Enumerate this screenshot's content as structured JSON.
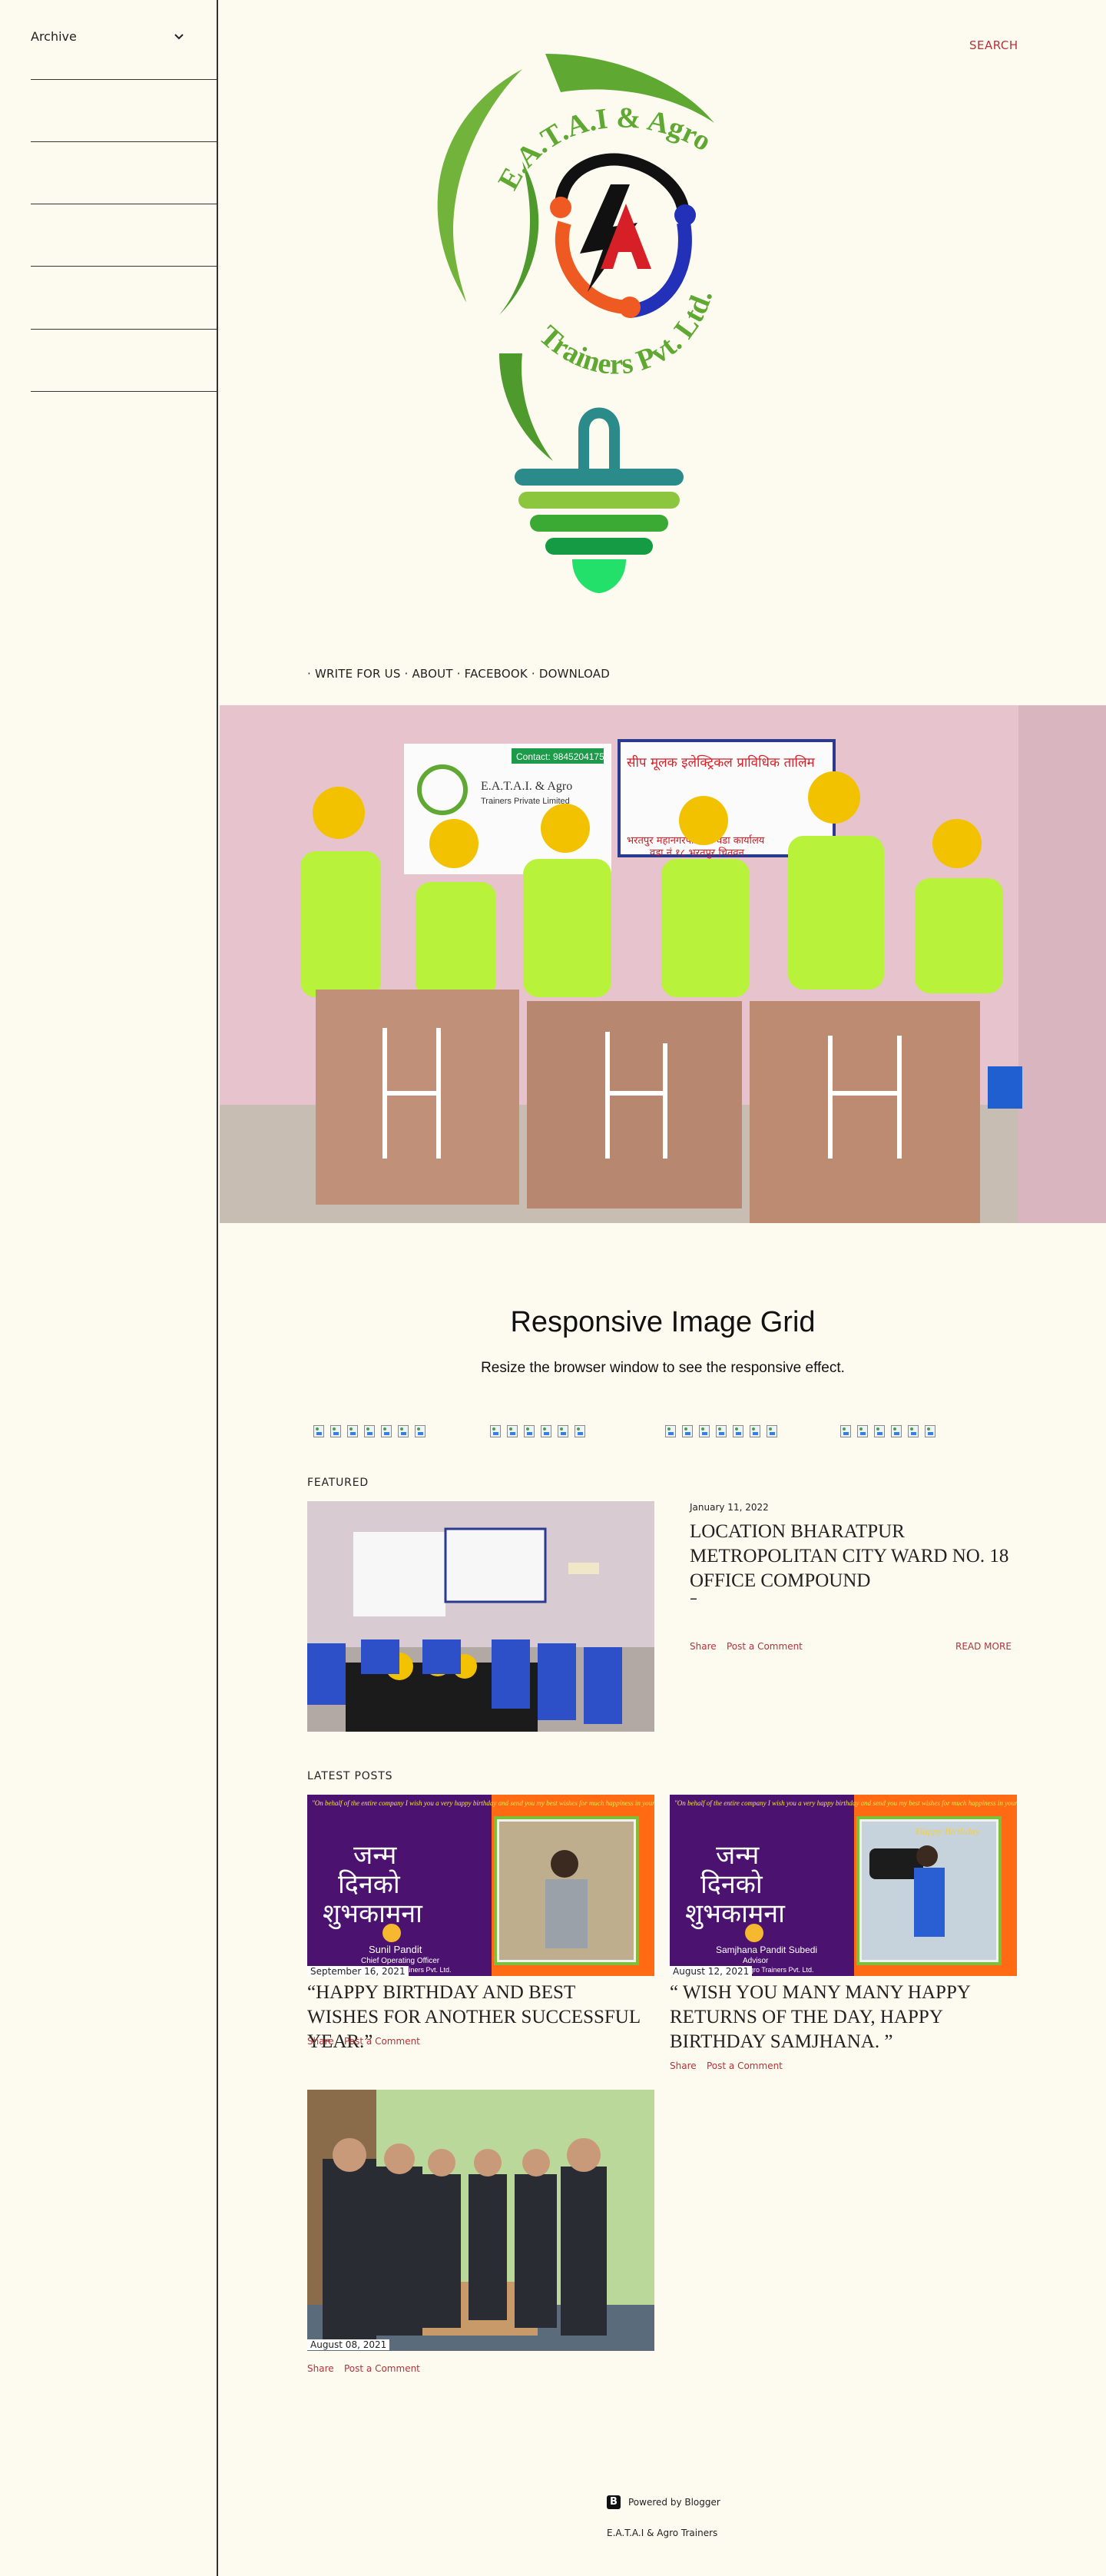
{
  "sidebar": {
    "archive_label": "Archive"
  },
  "header": {
    "search_label": "SEARCH",
    "logo_text_top": "E.A.T.A.I & Agro",
    "logo_text_bottom": "Trainers Pvt. Ltd.",
    "nav": [
      {
        "label": "WRITE FOR US"
      },
      {
        "label": "ABOUT"
      },
      {
        "label": "FACEBOOK"
      },
      {
        "label": "DOWNLOAD"
      }
    ]
  },
  "hero": {
    "banner_contact": "Contact: 9845204175",
    "banner_company": "E.A.T.A.I. & Agro",
    "banner_sub": "Trainers Private Limited",
    "banner_right_title": "सीप मूलक इलेक्ट्रिकल प्राविधिक तालिम",
    "banner_right_line1": "भरतपुर महानगरपालिका वडा कार्यालय",
    "banner_right_line2": "वडा नं १८ भरतपुर चितवन"
  },
  "grid": {
    "title": "Responsive Image Grid",
    "subtitle": "Resize the browser window to see the responsive effect."
  },
  "featured": {
    "label": "FEATURED",
    "date": "January 11, 2022",
    "title": "LOCATION BHARATPUR METROPOLITAN CITY WARD NO. 18 OFFICE COMPOUND",
    "dash": "–",
    "share": "Share",
    "comment": "Post a Comment",
    "read_more": "READ MORE"
  },
  "latest": {
    "label": "LATEST POSTS",
    "posts": [
      {
        "date": "September 16, 2021",
        "title": "“HAPPY BIRTHDAY AND BEST WISHES FOR ANOTHER SUCCESSFUL YEAR.”",
        "share": "Share",
        "comment": "Post a Comment",
        "card_quote": "\"On behalf of the entire company I wish you a very happy birthday and send you my best wishes for much happiness in your life.\"",
        "card_hindi1": "जन्म",
        "card_hindi2": "दिनको",
        "card_hindi3": "शुभकामना",
        "card_name": "Sunil Pandit",
        "card_role": "Chief Operating Officer",
        "card_company": "E.A.T.A.I. & Agro Trainers Pvt. Ltd."
      },
      {
        "date": "August 12, 2021",
        "title": "“ WISH YOU MANY MANY HAPPY RETURNS OF THE DAY, HAPPY BIRTHDAY SAMJHANA. ”",
        "share": "Share",
        "comment": "Post a Comment",
        "card_quote": "\"On behalf of the entire company I wish you a very happy birthday and send you my best wishes for much happiness in your life.\"",
        "card_hindi1": "जन्म",
        "card_hindi2": "दिनको",
        "card_hindi3": "शुभकामना",
        "card_name": "Samjhana Pandit Subedi",
        "card_role": "Advisor",
        "card_company": "E.A.T.A.I. & Agro Trainers Pvt. Ltd.",
        "card_happy": "Happy Birthday"
      },
      {
        "date": "August 08, 2021",
        "share": "Share",
        "comment": "Post a Comment"
      }
    ]
  },
  "footer": {
    "powered": "Powered by Blogger",
    "copyright": "E.A.T.A.I & Agro Trainers"
  },
  "colors": {
    "accent": "#b1333a",
    "background": "#fdfbf0"
  }
}
